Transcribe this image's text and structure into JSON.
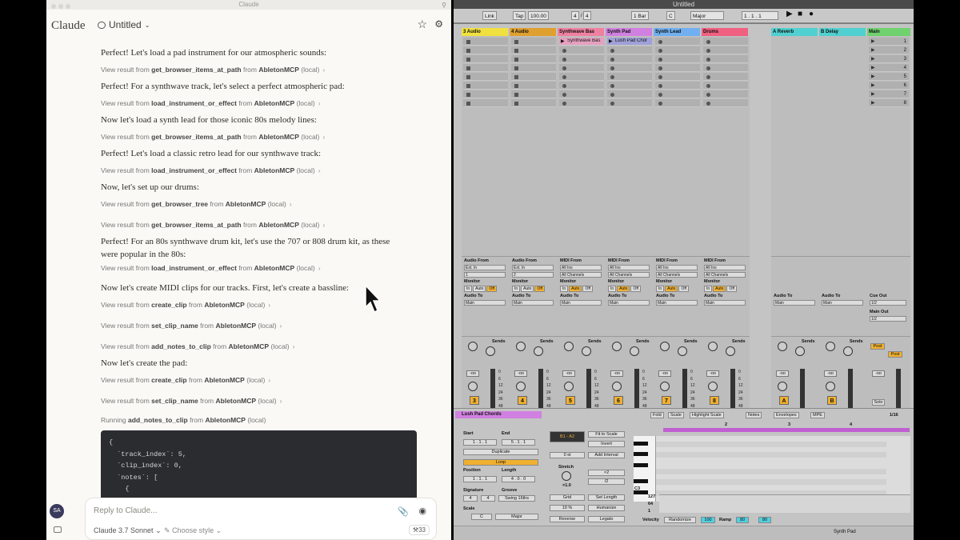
{
  "claude": {
    "titlebar": "Claude",
    "logo": "Claude",
    "conversation_title": "Untitled",
    "messages": [
      {
        "type": "text",
        "text": "Perfect! Let's load a pad instrument for our atmospheric sounds:"
      },
      {
        "type": "tool",
        "prefix": "View result from",
        "tool": "get_browser_items_at_path",
        "from": "from",
        "server": "AbletonMCP",
        "suffix": "(local)"
      },
      {
        "type": "text",
        "text": "Perfect! For a synthwave track, let's select a perfect atmospheric pad:"
      },
      {
        "type": "tool",
        "prefix": "View result from",
        "tool": "load_instrument_or_effect",
        "from": "from",
        "server": "AbletonMCP",
        "suffix": "(local)"
      },
      {
        "type": "text",
        "text": "Now let's load a synth lead for those iconic 80s melody lines:"
      },
      {
        "type": "tool",
        "prefix": "View result from",
        "tool": "get_browser_items_at_path",
        "from": "from",
        "server": "AbletonMCP",
        "suffix": "(local)"
      },
      {
        "type": "text",
        "text": "Perfect! Let's load a classic retro lead for our synthwave track:"
      },
      {
        "type": "tool",
        "prefix": "View result from",
        "tool": "load_instrument_or_effect",
        "from": "from",
        "server": "AbletonMCP",
        "suffix": "(local)"
      },
      {
        "type": "text",
        "text": "Now, let's set up our drums:"
      },
      {
        "type": "tool",
        "prefix": "View result from",
        "tool": "get_browser_tree",
        "from": "from",
        "server": "AbletonMCP",
        "suffix": "(local)"
      },
      {
        "type": "tool",
        "prefix": "View result from",
        "tool": "get_browser_items_at_path",
        "from": "from",
        "server": "AbletonMCP",
        "suffix": "(local)"
      },
      {
        "type": "text",
        "text": "Perfect! For an 80s synthwave drum kit, let's use the 707 or 808 drum kit, as these were popular in the 80s:"
      },
      {
        "type": "tool",
        "prefix": "View result from",
        "tool": "load_instrument_or_effect",
        "from": "from",
        "server": "AbletonMCP",
        "suffix": "(local)"
      },
      {
        "type": "text",
        "text": "Now let's create MIDI clips for our tracks. First, let's create a bassline:"
      },
      {
        "type": "tool",
        "prefix": "View result from",
        "tool": "create_clip",
        "from": "from",
        "server": "AbletonMCP",
        "suffix": "(local)"
      },
      {
        "type": "tool",
        "prefix": "View result from",
        "tool": "set_clip_name",
        "from": "from",
        "server": "AbletonMCP",
        "suffix": "(local)"
      },
      {
        "type": "tool",
        "prefix": "View result from",
        "tool": "add_notes_to_clip",
        "from": "from",
        "server": "AbletonMCP",
        "suffix": "(local)"
      },
      {
        "type": "text",
        "text": "Now let's create the pad:"
      },
      {
        "type": "tool",
        "prefix": "View result from",
        "tool": "create_clip",
        "from": "from",
        "server": "AbletonMCP",
        "suffix": "(local)"
      },
      {
        "type": "tool",
        "prefix": "View result from",
        "tool": "set_clip_name",
        "from": "from",
        "server": "AbletonMCP",
        "suffix": "(local)"
      },
      {
        "type": "running",
        "prefix": "Running",
        "tool": "add_notes_to_clip",
        "from": "from",
        "server": "AbletonMCP",
        "suffix": "(local)"
      }
    ],
    "code_lines": [
      "{",
      "  `track_index`: 5,",
      "  `clip_index`: 0,",
      "  `notes`: [",
      "    {"
    ],
    "input_placeholder": "Reply to Claude...",
    "model": "Claude 3.7 Sonnet",
    "style": "Choose style",
    "tool_count": "33",
    "avatar": "SA"
  },
  "ableton": {
    "title": "Untitled",
    "transport": {
      "link": "Link",
      "tap": "Tap",
      "tempo": "100.00",
      "sig_num": "4",
      "sig_den": "4",
      "bar": "1 Bar",
      "key": "C",
      "scale": "Major",
      "position": "1 .  1 .  1"
    },
    "tracks": [
      {
        "name": "3 Audio",
        "color": "#f0e040",
        "type": "audio",
        "number": "3",
        "input": "Ext. In",
        "channel": "1",
        "monitor_on": "Off",
        "out": "Main"
      },
      {
        "name": "4 Audio",
        "color": "#e0a030",
        "type": "audio",
        "number": "4",
        "input": "Ext. In",
        "channel": "2",
        "monitor_on": "Off",
        "out": "Main"
      },
      {
        "name": "Synthwave Bas",
        "color": "#f080a0",
        "type": "midi",
        "number": "5",
        "input": "All Ins",
        "channel": "All Channels",
        "monitor_on": "Auto",
        "out": "Main",
        "clip": "Synthwave Bas"
      },
      {
        "name": "Synth Pad",
        "color": "#d080e0",
        "type": "midi",
        "number": "6",
        "input": "All Ins",
        "channel": "All Channels",
        "monitor_on": "Auto",
        "out": "Main",
        "clip": "Lush Pad Chor"
      },
      {
        "name": "Synth Lead",
        "color": "#70b0f0",
        "type": "midi",
        "number": "7",
        "input": "All Ins",
        "channel": "All Channels",
        "monitor_on": "Auto",
        "out": "Main"
      },
      {
        "name": "Drums",
        "color": "#f06080",
        "type": "midi",
        "number": "8",
        "input": "All Ins",
        "channel": "All Channels",
        "monitor_on": "Auto",
        "out": "Main"
      }
    ],
    "returns": [
      {
        "name": "A Reverb",
        "color": "#50d0d0",
        "letter": "A",
        "out": "Main"
      },
      {
        "name": "B Delay",
        "color": "#50d0d0",
        "letter": "B",
        "out": "Main"
      }
    ],
    "main": {
      "name": "Main",
      "scenes": [
        "1",
        "2",
        "3",
        "4",
        "5",
        "6",
        "7",
        "8"
      ],
      "cue_out": "1/2",
      "main_out": "1/2",
      "post": "Post",
      "solo": "Solo"
    },
    "labels": {
      "audio_from": "Audio From",
      "midi_from": "MIDI From",
      "monitor": "Monitor",
      "in": "In",
      "auto": "Auto",
      "off": "Off",
      "audio_to": "Audio To",
      "sends": "Sends",
      "minus_inf": "-oo",
      "cue_out": "Cue Out",
      "main_out": "Main Out"
    },
    "db_scale": [
      "0",
      "6",
      "12",
      "24",
      "36",
      "48",
      "60"
    ],
    "detail": {
      "clip_name": "Lush Pad Chords",
      "start": "1 .  1 .  1",
      "end": "5 .  1 .  1",
      "duplicate": "Duplicate",
      "loop": "Loop",
      "position": "1 .  1 .  1",
      "length": "4 .  0 .  0",
      "signature_label": "Signature",
      "groove_label": "Groove",
      "sig_num": "4",
      "sig_den": "4",
      "groove": "Swing 16ths",
      "scale_label": "Scale",
      "scale_key": "C",
      "scale_name": "Major",
      "range": "B1 - A2",
      "fit": "Fit to Scale",
      "invert": "Invert",
      "semis": "0 st",
      "add_interval": "Add Interval",
      "stretch_label": "Stretch",
      "stretch": "×1.0",
      "x2": "×2",
      "div2": "/2",
      "grid": "Grid",
      "set_length": "Set Length",
      "percent": "10 %",
      "humanize": "Humanize",
      "reverse": "Reverse",
      "legato": "Legato",
      "start_label": "Start",
      "end_label": "End",
      "position_label": "Position",
      "length_label": "Length",
      "set": "Set",
      "tabs": [
        "Fold",
        "Scale",
        "Highlight Scale",
        "Notes",
        "Envelopes",
        "MPE"
      ],
      "quant": "1/16",
      "bars": [
        "2",
        "3",
        "4"
      ],
      "velocity_label": "Velocity",
      "randomize": "Randomize",
      "vel_value": "100",
      "ramp_label": "Ramp",
      "ramp_a": "80",
      "ramp_b": "80",
      "vel_axis": [
        "127",
        "64",
        "1"
      ],
      "octave_label": "C3"
    },
    "statusbar_track": "Synth Pad"
  }
}
